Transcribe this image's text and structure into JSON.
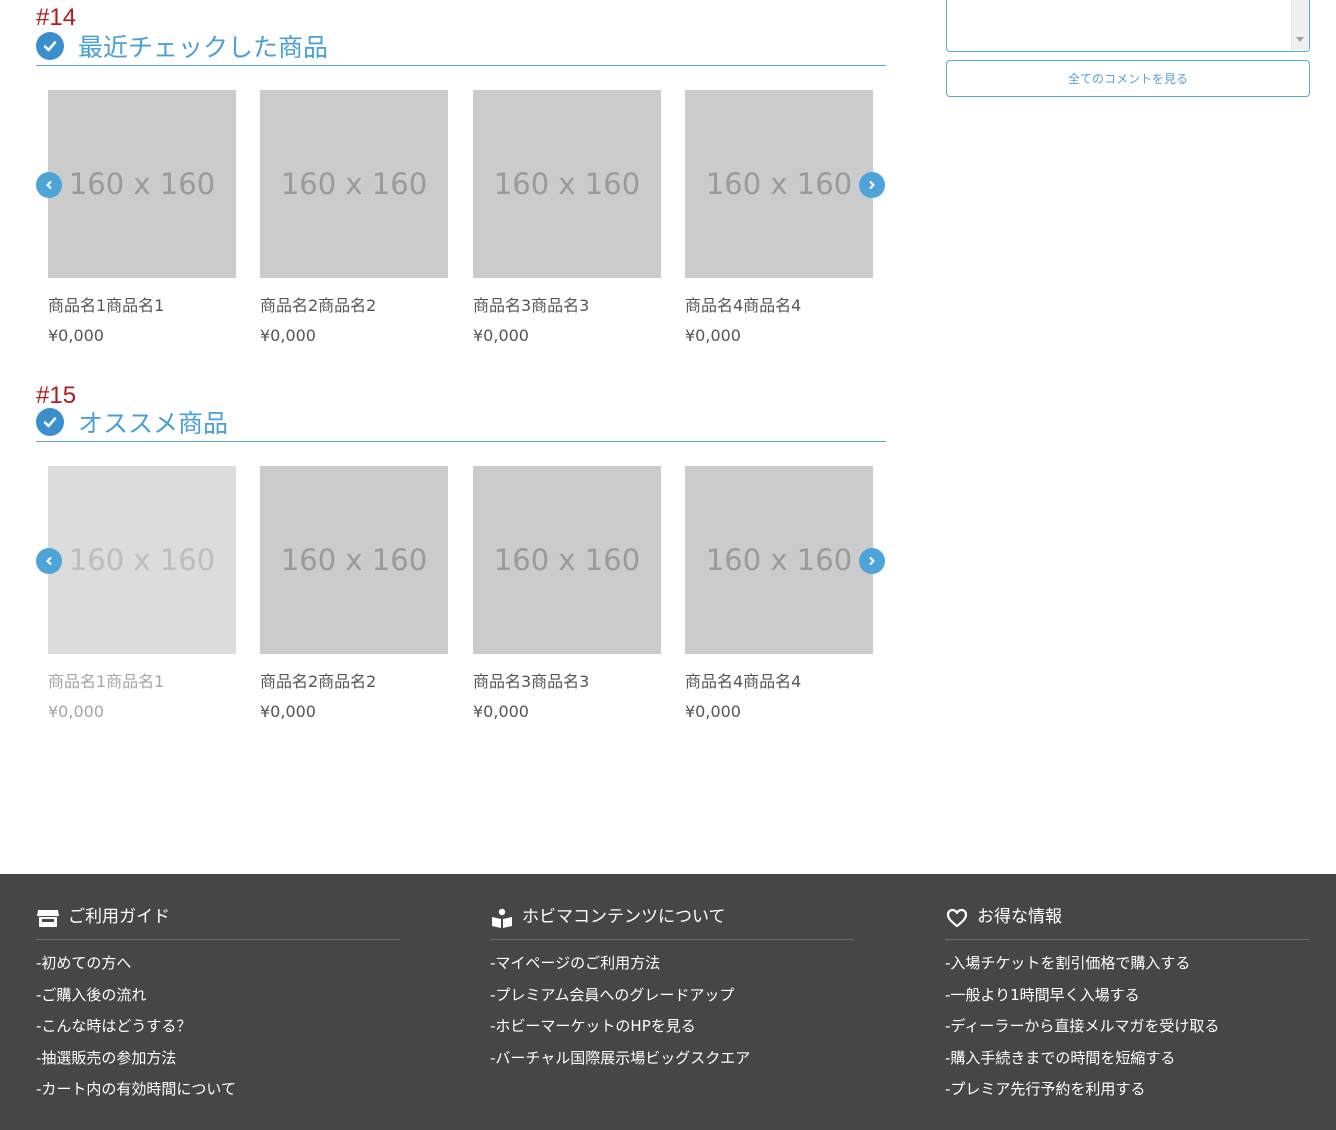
{
  "sections": [
    {
      "number": "#14",
      "title": "最近チェックした商品",
      "products": [
        {
          "image_text": "160 x 160",
          "name": "商品名1商品名1",
          "price": "¥0,000"
        },
        {
          "image_text": "160 x 160",
          "name": "商品名2商品名2",
          "price": "¥0,000"
        },
        {
          "image_text": "160 x 160",
          "name": "商品名3商品名3",
          "price": "¥0,000"
        },
        {
          "image_text": "160 x 160",
          "name": "商品名4商品名4",
          "price": "¥0,000"
        }
      ]
    },
    {
      "number": "#15",
      "title": "オススメ商品",
      "products": [
        {
          "image_text": "160 x 160",
          "name": "商品名1商品名1",
          "price": "¥0,000"
        },
        {
          "image_text": "160 x 160",
          "name": "商品名2商品名2",
          "price": "¥0,000"
        },
        {
          "image_text": "160 x 160",
          "name": "商品名3商品名3",
          "price": "¥0,000"
        },
        {
          "image_text": "160 x 160",
          "name": "商品名4商品名4",
          "price": "¥0,000"
        }
      ]
    }
  ],
  "comments": {
    "all_comments_label": "全てのコメントを見る"
  },
  "footer": {
    "columns": [
      {
        "icon": "shop-icon",
        "title": "ご利用ガイド",
        "links": [
          "-初めての方へ",
          "-ご購入後の流れ",
          "-こんな時はどうする？",
          "-抽選販売の参加方法",
          "-カート内の有効時間について"
        ]
      },
      {
        "icon": "reading-person-icon",
        "title": "ホビマコンテンツについて",
        "links": [
          "-マイページのご利用方法",
          "-プレミアム会員へのグレードアップ",
          "-ホビーマーケットのHPを見る",
          "-バーチャル国際展示場ビッグスクエア"
        ]
      },
      {
        "icon": "heart-icon",
        "title": "お得な情報",
        "links": [
          "-入場チケットを割引価格で購入する",
          "-一般より1時間早く入場する",
          "-ディーラーから直接メルマガを受け取る",
          "-購入手続きまでの時間を短縮する",
          "-プレミア先行予約を利用する"
        ]
      }
    ]
  },
  "colors": {
    "accent": "#4a9fd6",
    "section_number": "#b01c1c",
    "footer_bg": "#464646",
    "placeholder_bg": "#cbcbcb"
  }
}
